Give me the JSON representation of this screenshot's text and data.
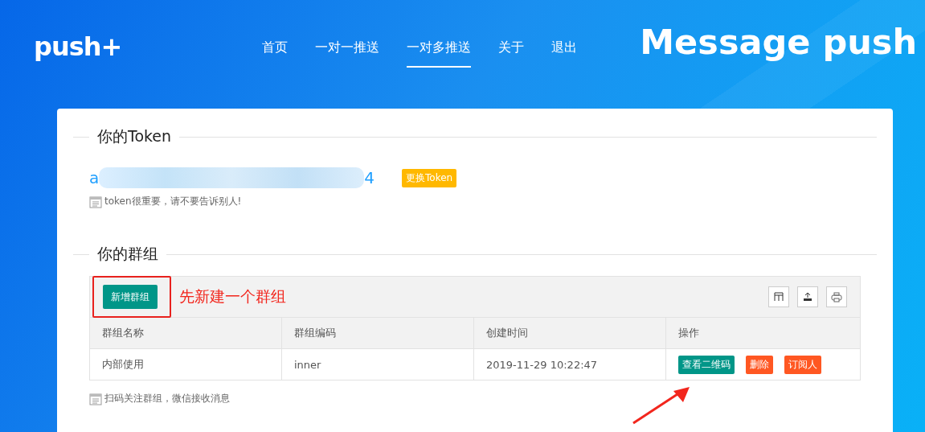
{
  "header": {
    "logo": "push+",
    "nav": [
      {
        "label": "首页",
        "selected": false
      },
      {
        "label": "一对一推送",
        "selected": false
      },
      {
        "label": "一对多推送",
        "selected": true
      },
      {
        "label": "关于",
        "selected": false
      },
      {
        "label": "退出",
        "selected": false
      }
    ],
    "banner": "Message push"
  },
  "token_section": {
    "title": "你的Token",
    "token_start": "a",
    "token_end": "4",
    "change_button": "更换Token",
    "hint": "token很重要，请不要告诉别人!"
  },
  "group_section": {
    "title": "你的群组",
    "add_button": "新增群组",
    "annotation": "先新建一个群组",
    "table": {
      "columns": [
        "群组名称",
        "群组编码",
        "创建时间",
        "操作"
      ],
      "rows": [
        {
          "cells": [
            "内部使用",
            "inner",
            "2019-11-29 10:22:47"
          ],
          "actions": [
            {
              "label": "查看二维码",
              "kind": "primary"
            },
            {
              "label": "删除",
              "kind": "danger"
            },
            {
              "label": "订阅人",
              "kind": "danger"
            }
          ]
        }
      ]
    },
    "hint": "扫码关注群组，微信接收消息"
  }
}
